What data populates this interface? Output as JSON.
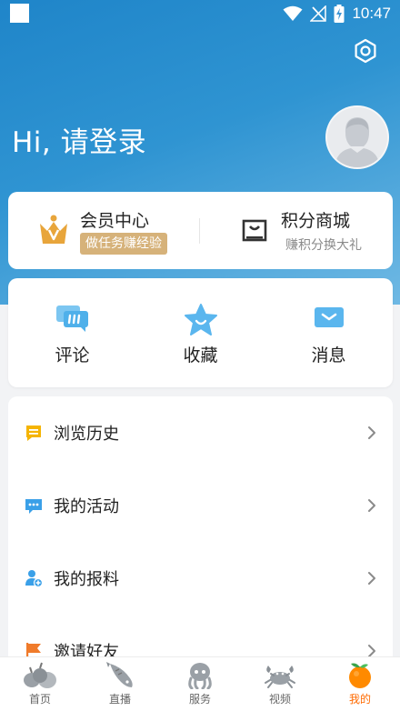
{
  "status_bar": {
    "time": "10:47"
  },
  "header": {
    "greeting": "Hi, 请登录"
  },
  "member_card": {
    "member": {
      "title": "会员中心",
      "badge": "做任务赚经验"
    },
    "points_mall": {
      "title": "积分商城",
      "subtitle": "赚积分换大礼"
    }
  },
  "actions": [
    {
      "label": "评论",
      "icon": "comment-icon"
    },
    {
      "label": "收藏",
      "icon": "star-icon"
    },
    {
      "label": "消息",
      "icon": "message-icon"
    }
  ],
  "menu": [
    {
      "label": "浏览历史",
      "icon": "history-icon",
      "color": "#f5b400"
    },
    {
      "label": "我的活动",
      "icon": "activity-icon",
      "color": "#3aa0e8"
    },
    {
      "label": "我的报料",
      "icon": "report-icon",
      "color": "#3aa0e8"
    },
    {
      "label": "邀请好友",
      "icon": "flag-icon",
      "color": "#f07b2b"
    }
  ],
  "tabbar": {
    "tabs": [
      {
        "label": "首页",
        "icon": "garlic-icon"
      },
      {
        "label": "直播",
        "icon": "fish-icon"
      },
      {
        "label": "服务",
        "icon": "octopus-icon"
      },
      {
        "label": "视频",
        "icon": "crab-icon"
      },
      {
        "label": "我的",
        "icon": "orange-icon"
      }
    ],
    "active_index": 4,
    "active_color": "#ff6a00"
  },
  "colors": {
    "header_blue": "#1f85c9",
    "gold": "#d6b27a"
  }
}
